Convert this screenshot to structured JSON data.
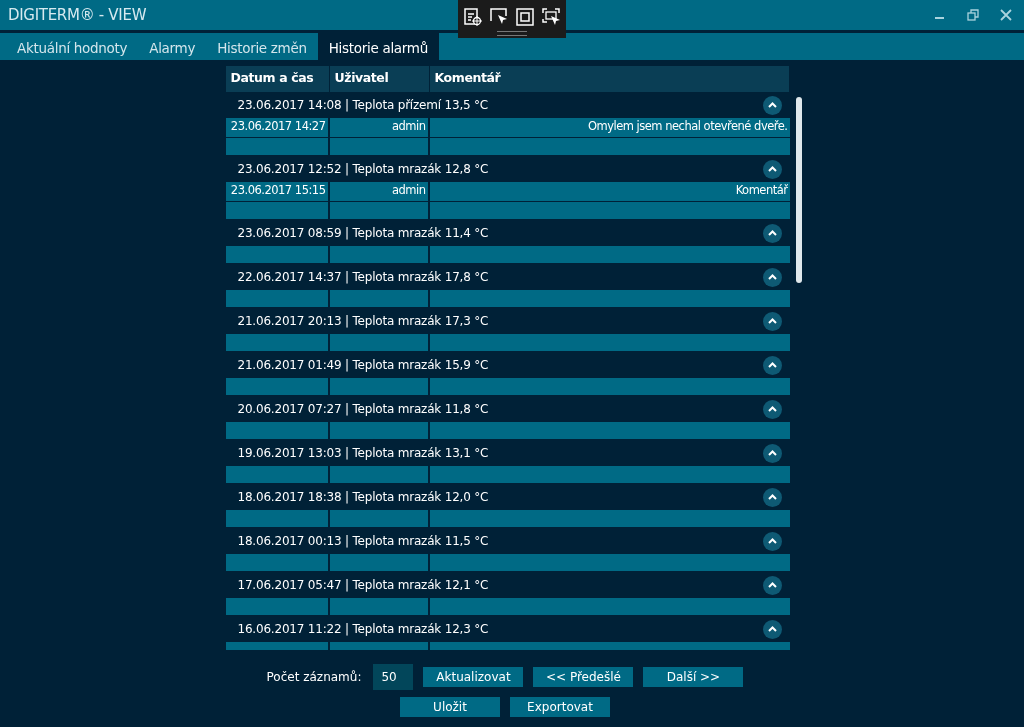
{
  "window": {
    "title": "DIGITERM® - VIEW"
  },
  "tabs": [
    {
      "label": "Aktuální hodnoty",
      "selected": false
    },
    {
      "label": "Alarmy",
      "selected": false
    },
    {
      "label": "Historie změn",
      "selected": false
    },
    {
      "label": "Historie alarmů",
      "selected": true
    }
  ],
  "table": {
    "columns": [
      "Datum a čas",
      "Uživatel",
      "Komentář"
    ],
    "groups": [
      {
        "title": "23.06.2017 14:08 | Teplota přízemí 13,5 °C",
        "expanded": true,
        "rows": [
          {
            "date": "23.06.2017 14:27",
            "user": "admin",
            "comment": "Omylem jsem nechal otevřené dveře."
          }
        ]
      },
      {
        "title": "23.06.2017 12:52 | Teplota mrazák 12,8 °C",
        "expanded": true,
        "rows": [
          {
            "date": "23.06.2017 15:15",
            "user": "admin",
            "comment": "Komentář"
          }
        ]
      },
      {
        "title": "23.06.2017 08:59 | Teplota mrazák 11,4 °C",
        "expanded": true
      },
      {
        "title": "22.06.2017 14:37 | Teplota mrazák 17,8 °C",
        "expanded": true
      },
      {
        "title": "21.06.2017 20:13 | Teplota mrazák 17,3 °C",
        "expanded": true
      },
      {
        "title": "21.06.2017 01:49 | Teplota mrazák 15,9 °C",
        "expanded": true
      },
      {
        "title": "20.06.2017 07:27 | Teplota mrazák 11,8 °C",
        "expanded": true
      },
      {
        "title": "19.06.2017 13:03 | Teplota mrazák 13,1 °C",
        "expanded": true
      },
      {
        "title": "18.06.2017 18:38 | Teplota mrazák 12,0 °C",
        "expanded": true
      },
      {
        "title": "18.06.2017 00:13 | Teplota mrazák 11,5 °C",
        "expanded": true
      },
      {
        "title": "17.06.2017 05:47 | Teplota mrazák 12,1 °C",
        "expanded": true
      },
      {
        "title": "16.06.2017 11:22 | Teplota mrazák 12,3 °C",
        "expanded": true
      }
    ]
  },
  "footer": {
    "count_label": "Počet záznamů:",
    "count_value": "50",
    "buttons": [
      "Aktualizovat",
      "<< Předešlé",
      "Další >>"
    ],
    "buttons_2": [
      "Uložit",
      "Exportovat"
    ]
  }
}
